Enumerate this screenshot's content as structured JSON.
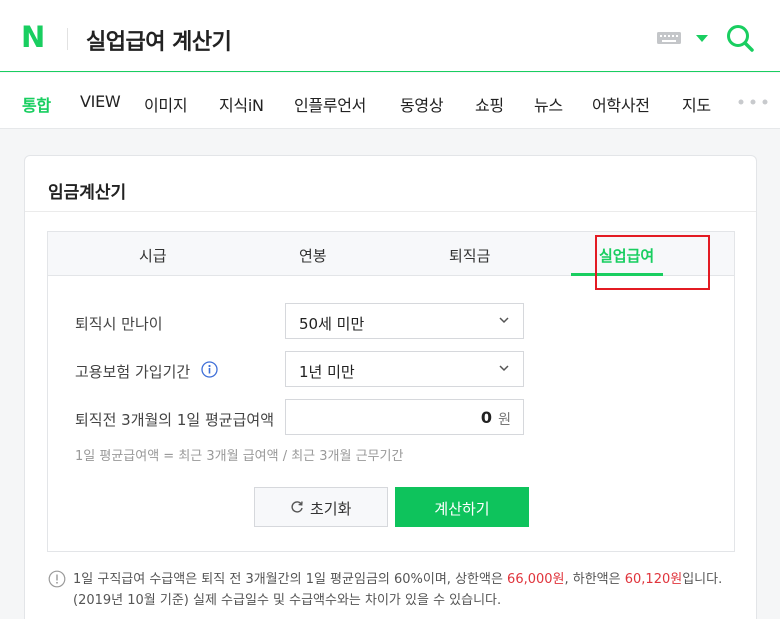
{
  "header": {
    "query": "실업급여 계산기",
    "logo_letter": "N",
    "keyboard_icon": "keyboard-icon",
    "search_icon": "search-icon",
    "brand_color": "#19ce60"
  },
  "nav": {
    "items": [
      "통합",
      "VIEW",
      "이미지",
      "지식iN",
      "인플루언서",
      "동영상",
      "쇼핑",
      "뉴스",
      "어학사전",
      "지도"
    ],
    "active_index": 0,
    "more_icon": "more-dots-icon"
  },
  "card": {
    "title": "임금계산기",
    "tabs": [
      "시급",
      "연봉",
      "퇴직금",
      "실업급여"
    ],
    "active_tab": "실업급여",
    "highlight_color": "#e31b23",
    "form": {
      "age_label": "퇴직시 만나이",
      "age_value": "50세 미만",
      "period_label": "고용보험 가입기간",
      "period_value": "1년 미만",
      "wage_label": "퇴직전 3개월의 1일 평균급여액",
      "wage_value": "0",
      "wage_unit": "원",
      "formula": "1일 평균급여액 = 최근 3개월 급여액 / 최근 3개월 근무기간"
    },
    "buttons": {
      "reset": "초기화",
      "calculate": "계산하기"
    },
    "notice": {
      "part1": "1일 구직급여 수급액은 퇴직 전 3개월간의 1일 평균임금의 60%이며, 상한액은 ",
      "upper": "66,000원",
      "part2": ", 하한액은 ",
      "lower": "60,120원",
      "part3": "입니다. (2019년 10월 기준) 실제 수급일수 및 수급액수와는 차이가 있을 수 있습니다."
    }
  }
}
